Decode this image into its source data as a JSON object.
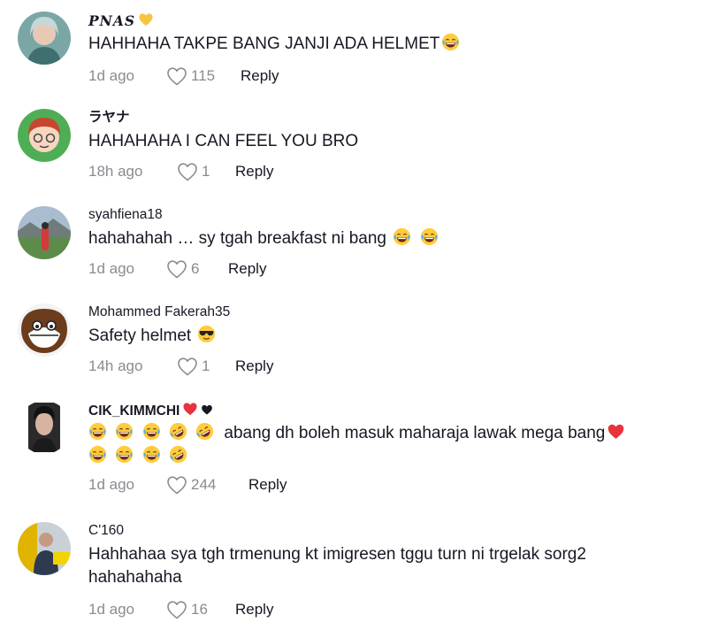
{
  "comments": [
    {
      "username": "PNAS",
      "text": "HAHHAHA TAKPE BANG JANJI ADA HELMET",
      "time": "1d ago",
      "likes": "115",
      "reply": "Reply"
    },
    {
      "username": "ラヤナ",
      "text": "HAHAHAHA I CAN FEEL YOU BRO",
      "time": "18h ago",
      "likes": "1",
      "reply": "Reply"
    },
    {
      "username": "syahfiena18",
      "text": "hahahahah … sy tgah breakfast ni bang",
      "time": "1d ago",
      "likes": "6",
      "reply": "Reply"
    },
    {
      "username": "Mohammed Fakerah35",
      "text": "Safety helmet",
      "time": "14h ago",
      "likes": "1",
      "reply": "Reply"
    },
    {
      "username": "CIK_KIMMCHI",
      "text": "abang dh boleh masuk maharaja lawak mega bang",
      "time": "1d ago",
      "likes": "244",
      "reply": "Reply"
    },
    {
      "username": "C'160",
      "text_line1": "Hahhahaa sya tgh trmenung kt imigresen tggu turn ni trgelak sorg2",
      "text_line2": "hahahahaha",
      "time": "1d ago",
      "likes": "16",
      "reply": "Reply"
    }
  ],
  "colors": {
    "text": "#161823",
    "meta": "#8a8b91",
    "heart_red": "#e8323c",
    "gold": "#f5c542"
  },
  "icons": [
    "heart-outline-icon",
    "yellow-heart-icon",
    "red-heart-icon",
    "black-heart-icon",
    "joy-emoji",
    "rofl-emoji",
    "sunglasses-emoji"
  ]
}
